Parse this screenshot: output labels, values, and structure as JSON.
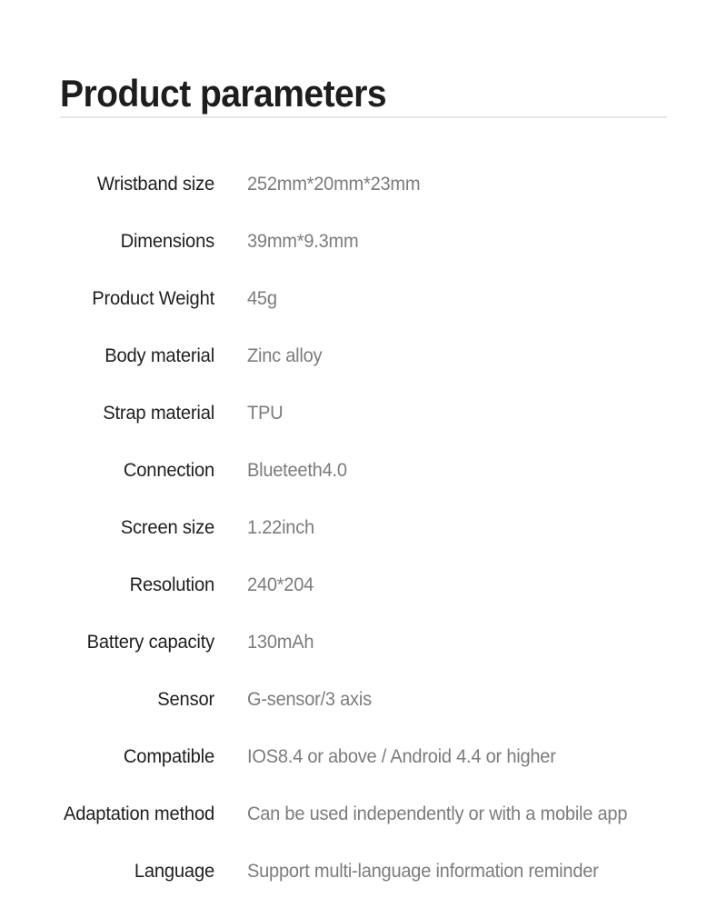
{
  "header": {
    "title": "Product parameters"
  },
  "specs": {
    "rows": [
      {
        "label": "Wristband size",
        "value": "252mm*20mm*23mm"
      },
      {
        "label": "Dimensions",
        "value": "39mm*9.3mm"
      },
      {
        "label": "Product Weight",
        "value": "45g"
      },
      {
        "label": "Body material",
        "value": "Zinc alloy"
      },
      {
        "label": "Strap material",
        "value": "TPU"
      },
      {
        "label": "Connection",
        "value": "Blueteeth4.0"
      },
      {
        "label": "Screen size",
        "value": "1.22inch"
      },
      {
        "label": "Resolution",
        "value": "240*204"
      },
      {
        "label": "Battery capacity",
        "value": "130mAh"
      },
      {
        "label": "Sensor",
        "value": "G-sensor/3 axis"
      },
      {
        "label": "Compatible",
        "value": "IOS8.4 or above / Android 4.4 or higher"
      },
      {
        "label": "Adaptation method",
        "value": "Can be used independently or with a mobile app"
      },
      {
        "label": "Language",
        "value": "Support multi-language information reminder"
      }
    ]
  },
  "style": {
    "background": "#ffffff",
    "title_color": "#1d1d1f",
    "label_color": "#1f1f1f",
    "value_color": "#7c7c7e",
    "divider_color": "#e6e6e8"
  }
}
